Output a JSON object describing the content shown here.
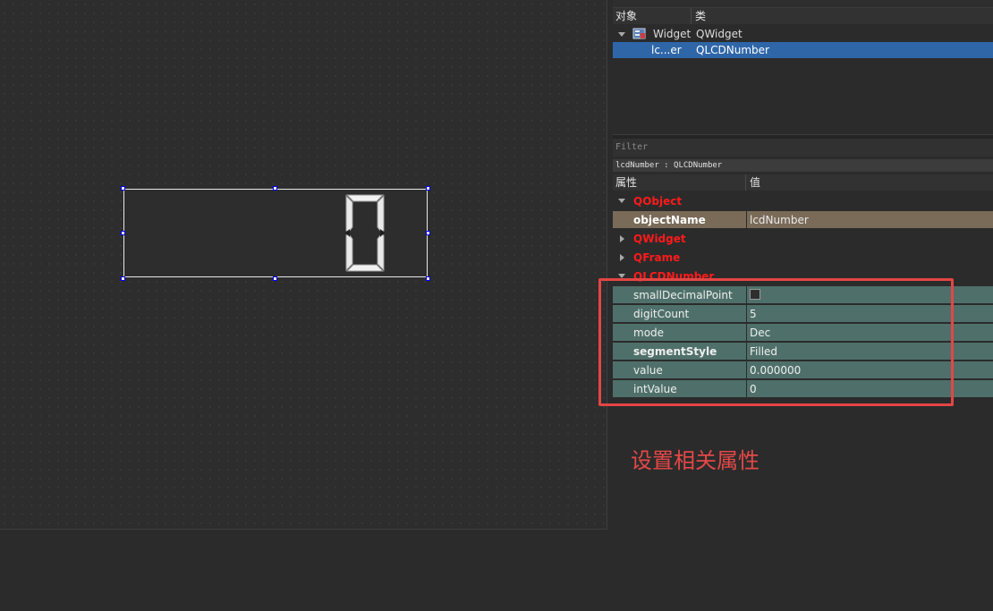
{
  "object_inspector": {
    "headers": {
      "object": "对象",
      "class": "类"
    },
    "rows": [
      {
        "name": "Widget",
        "class": "QWidget"
      },
      {
        "name": "lc...er",
        "class": "QLCDNumber"
      }
    ]
  },
  "property_editor": {
    "filter_placeholder": "Filter",
    "class_line": "lcdNumber : QLCDNumber",
    "headers": {
      "property": "属性",
      "value": "值"
    },
    "groups": {
      "qobject": "QObject",
      "qwidget": "QWidget",
      "qframe": "QFrame",
      "qlcdnumber": "QLCDNumber"
    },
    "rows": {
      "objectName": {
        "label": "objectName",
        "value": "lcdNumber"
      },
      "smallDecimalPoint": {
        "label": "smallDecimalPoint",
        "checked": false
      },
      "digitCount": {
        "label": "digitCount",
        "value": "5"
      },
      "mode": {
        "label": "mode",
        "value": "Dec"
      },
      "segmentStyle": {
        "label": "segmentStyle",
        "value": "Filled"
      },
      "value": {
        "label": "value",
        "value": "0.000000"
      },
      "intValue": {
        "label": "intValue",
        "value": "0"
      }
    }
  },
  "canvas": {
    "lcd_display_text": "0"
  },
  "annotation": {
    "text": "设置相关属性",
    "color": "#e54848"
  },
  "colors": {
    "selected_row": "#7a6a58",
    "selection_blue": "#2f66a8",
    "lcd_rows": "#4f706a",
    "group_label": "#ff1a1a"
  }
}
